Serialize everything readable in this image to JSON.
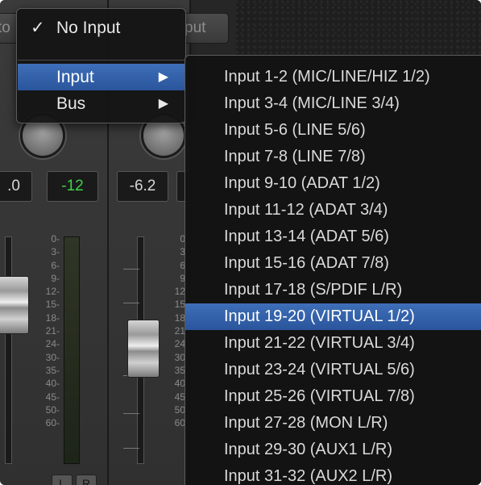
{
  "top_buttons": {
    "left_partial": "to",
    "right_partial": "put"
  },
  "readouts": {
    "strip1_volume": ".0",
    "strip1_peak": "-12",
    "strip2_volume": "-6.2"
  },
  "meter_scale": [
    "0",
    "3",
    "6",
    "9",
    "12",
    "15",
    "18",
    "21",
    "24",
    "30",
    "35",
    "40",
    "45",
    "50",
    "60"
  ],
  "meter_scale_partial": [
    "0",
    "3",
    "6",
    "9",
    "12",
    "15",
    "18",
    "21",
    "24",
    "30",
    "35",
    "40",
    "45",
    "50",
    "60"
  ],
  "stereo_buttons": {
    "left": "L",
    "right": "R"
  },
  "menu": {
    "check_mark": "✓",
    "no_input": "No Input",
    "input": "Input",
    "bus": "Bus",
    "submenu_arrow": "▶"
  },
  "input_submenu": [
    "Input 1-2  (MIC/LINE/HIZ 1/2)",
    "Input 3-4  (MIC/LINE 3/4)",
    "Input 5-6  (LINE 5/6)",
    "Input 7-8  (LINE 7/8)",
    "Input 9-10  (ADAT 1/2)",
    "Input 11-12  (ADAT 3/4)",
    "Input 13-14  (ADAT 5/6)",
    "Input 15-16  (ADAT 7/8)",
    "Input 17-18  (S/PDIF L/R)",
    "Input 19-20  (VIRTUAL 1/2)",
    "Input 21-22  (VIRTUAL 3/4)",
    "Input 23-24  (VIRTUAL 5/6)",
    "Input 25-26  (VIRTUAL 7/8)",
    "Input 27-28  (MON L/R)",
    "Input 29-30  (AUX1 L/R)",
    "Input 31-32  (AUX2 L/R)"
  ],
  "selected_submenu_item": "Input 19-20  (VIRTUAL 1/2)",
  "colors": {
    "highlight": "#2f5fa8",
    "peak_green": "#3fd34a"
  }
}
